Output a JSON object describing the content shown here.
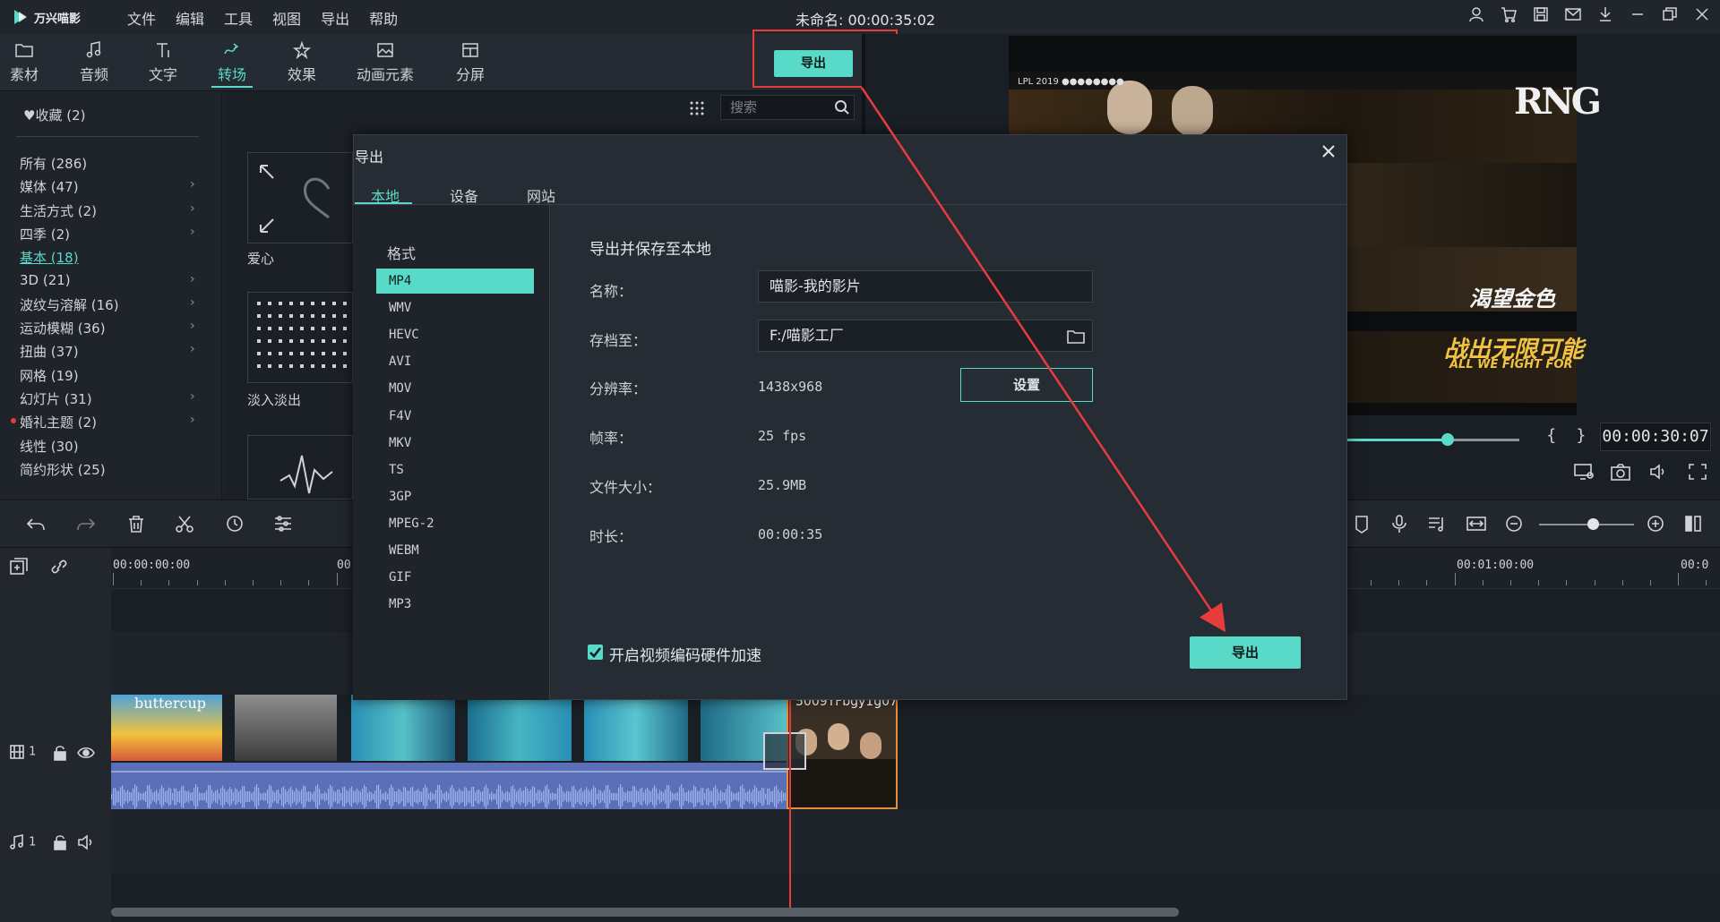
{
  "app": {
    "name": "万兴喵影",
    "document_title": "未命名: 00:00:35:02"
  },
  "menu": [
    "文件",
    "编辑",
    "工具",
    "视图",
    "导出",
    "帮助"
  ],
  "tabs": [
    {
      "label": "素材",
      "icon": "folder-icon"
    },
    {
      "label": "音频",
      "icon": "music-note-icon"
    },
    {
      "label": "文字",
      "icon": "text-icon"
    },
    {
      "label": "转场",
      "icon": "transition-icon",
      "active": true
    },
    {
      "label": "效果",
      "icon": "effects-icon"
    },
    {
      "label": "动画元素",
      "icon": "image-icon"
    },
    {
      "label": "分屏",
      "icon": "split-screen-icon"
    }
  ],
  "toolbar": {
    "export_label": "导出"
  },
  "sidebar": {
    "favorites": "收藏 (2)",
    "categories": [
      {
        "label": "所有 (286)",
        "arrow": false
      },
      {
        "label": "媒体 (47)",
        "arrow": true
      },
      {
        "label": "生活方式 (2)",
        "arrow": true
      },
      {
        "label": "四季 (2)",
        "arrow": true
      },
      {
        "label": "基本 (18)",
        "arrow": false,
        "active": true
      },
      {
        "label": "3D (21)",
        "arrow": true
      },
      {
        "label": "波纹与溶解 (16)",
        "arrow": true
      },
      {
        "label": "运动模糊 (36)",
        "arrow": true
      },
      {
        "label": "扭曲 (37)",
        "arrow": true
      },
      {
        "label": "网格 (19)",
        "arrow": false
      },
      {
        "label": "幻灯片 (31)",
        "arrow": true
      },
      {
        "label": "婚礼主题 (2)",
        "arrow": true
      },
      {
        "label": "线性 (30)",
        "arrow": false
      },
      {
        "label": "简约形状 (25)",
        "arrow": false
      }
    ]
  },
  "content": {
    "search_placeholder": "搜索",
    "thumbs": [
      {
        "label": "爱心"
      },
      {
        "label": "淡入淡出"
      }
    ]
  },
  "preview": {
    "timecode": "00:00:30:07",
    "progress": 0.59,
    "overlay_texts": [
      "渴望金色",
      "战出无限可能",
      "ALL WE FIGHT FOR"
    ]
  },
  "timeline": {
    "ruler_labels": [
      "00:00:00:00",
      "00",
      "00:01:00:00",
      "00:0"
    ],
    "video_track_label": "1",
    "audio_track_label": "1",
    "clip_names": [
      "buttercup",
      "5009YFbgy1g07"
    ]
  },
  "dialog": {
    "title": "导出",
    "tabs": [
      "本地",
      "设备",
      "网站"
    ],
    "formats_title": "格式",
    "formats": [
      "MP4",
      "WMV",
      "HEVC",
      "AVI",
      "MOV",
      "F4V",
      "MKV",
      "TS",
      "3GP",
      "MPEG-2",
      "WEBM",
      "GIF",
      "MP3"
    ],
    "section_title": "导出并保存至本地",
    "name_label": "名称：",
    "name_value": "喵影-我的影片",
    "save_label": "存档至：",
    "save_value": "F:/喵影工厂",
    "resolution_label": "分辨率：",
    "resolution_value": "1438x968",
    "settings_button": "设置",
    "fps_label": "帧率：",
    "fps_value": "25 fps",
    "size_label": "文件大小：",
    "size_value": "25.9MB",
    "duration_label": "时长：",
    "duration_value": "00:00:35",
    "hw_accel_label": "开启视频编码硬件加速",
    "hw_accel_checked": true,
    "export_button": "导出"
  },
  "colors": {
    "accent": "#59d9c7",
    "annotation": "#e83b3b"
  }
}
